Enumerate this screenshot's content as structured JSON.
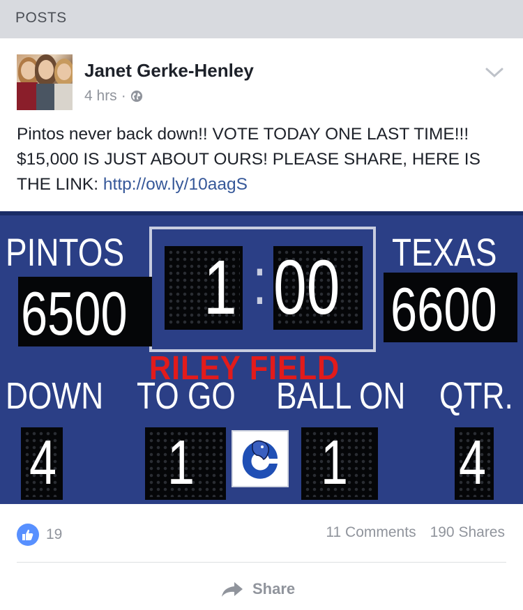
{
  "section": {
    "title": "POSTS"
  },
  "post": {
    "author": "Janet Gerke-Henley",
    "time": "4 hrs",
    "separator": "·",
    "text": "Pintos never back down!! VOTE TODAY ONE LAST TIME!!! $15,000 IS JUST ABOUT OURS! PLEASE SHARE, HERE IS THE LINK: ",
    "link": "http://ow.ly/10aagS"
  },
  "scoreboard": {
    "home_label": "PINTOS",
    "home_score": "6500",
    "away_label": "TEXAS",
    "away_score": "6600",
    "clock_min": "1",
    "clock_colon": ":",
    "clock_sec": "00",
    "field": "RILEY FIELD",
    "down_label": "DOWN",
    "down_value": "4",
    "togo_label": "TO GO",
    "togo_value": "1",
    "ballon_label": "BALL ON",
    "ballon_value": "1",
    "qtr_label": "QTR.",
    "qtr_value": "4"
  },
  "footer": {
    "likes": "19",
    "comments": "11 Comments",
    "shares": "190 Shares",
    "share_label": "Share"
  },
  "colors": {
    "accent": "#365899",
    "like_blue": "#5890ff",
    "scoreboard_blue": "#2b3f86",
    "field_red": "#e21b1b"
  },
  "icons": [
    "globe-icon",
    "chevron-down-icon",
    "like-icon",
    "share-arrow-icon"
  ]
}
